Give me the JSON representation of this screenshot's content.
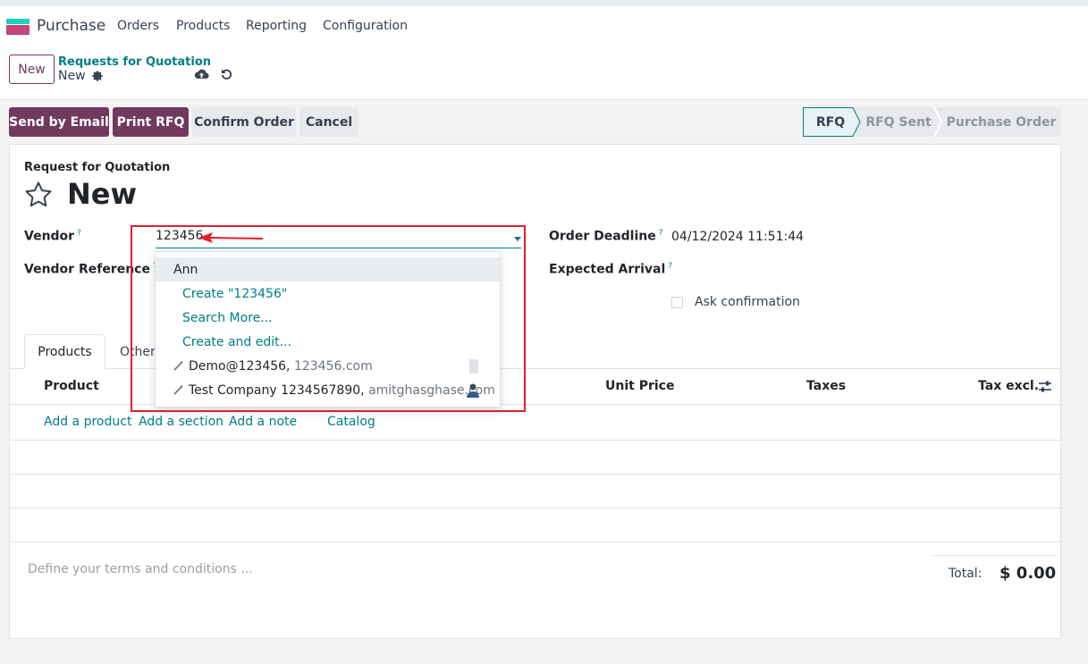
{
  "navbar": {
    "app_name": "Purchase",
    "menu": [
      "Orders",
      "Products",
      "Reporting",
      "Configuration"
    ]
  },
  "control_panel": {
    "new_button": "New",
    "breadcrumb_parent": "Requests for Quotation",
    "breadcrumb_current": "New"
  },
  "actions": {
    "send_by_email": "Send by Email",
    "print_rfq": "Print RFQ",
    "confirm_order": "Confirm Order",
    "cancel": "Cancel"
  },
  "stages": [
    "RFQ",
    "RFQ Sent",
    "Purchase Order"
  ],
  "form": {
    "doc_type": "Request for Quotation",
    "title": "New",
    "vendor_label": "Vendor",
    "vendor_value": "123456",
    "vendor_ref_label": "Vendor Reference",
    "order_deadline_label": "Order Deadline",
    "order_deadline_value": "04/12/2024 11:51:44",
    "expected_arrival_label": "Expected Arrival",
    "ask_confirmation_label": "Ask confirmation",
    "help_mark": "?"
  },
  "tabs": [
    "Products",
    "Other"
  ],
  "lines_table": {
    "headers": [
      "Product",
      "Unit Price",
      "Taxes",
      "Tax excl."
    ],
    "add_links": [
      "Add a product",
      "Add a section",
      "Add a note",
      "Catalog"
    ]
  },
  "footer": {
    "terms_placeholder": "Define your terms and conditions ...",
    "total_label": "Total:",
    "total_value": "$ 0.00"
  },
  "dropdown": {
    "items": [
      {
        "kind": "record",
        "label": "Ann"
      },
      {
        "kind": "action",
        "label": "Create \"123456\""
      },
      {
        "kind": "action",
        "label": "Search More..."
      },
      {
        "kind": "action",
        "label": "Create and edit..."
      },
      {
        "kind": "suggestion",
        "label": "Demo@123456,",
        "sub": "123456.com"
      },
      {
        "kind": "suggestion",
        "label": "Test Company 1234567890,",
        "sub": "amitghasghase.com"
      }
    ]
  },
  "colors": {
    "brand": "#71395e",
    "accent": "#017e84",
    "annotation": "#e0202a"
  }
}
